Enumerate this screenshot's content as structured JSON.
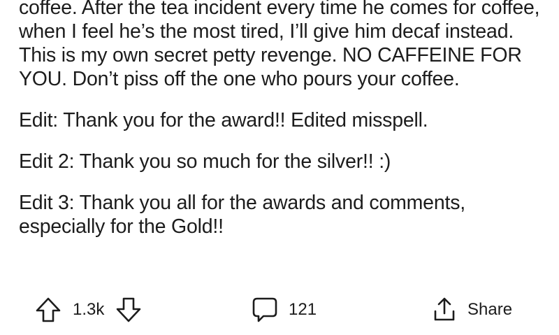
{
  "post": {
    "paragraphs": [
      "coffee. After the tea incident every time he comes for coffee, when I feel he’s the most tired, I’ll give him decaf instead. This is my own secret petty revenge. NO CAFFEINE FOR YOU. Don’t piss off the one who pours your coffee.",
      "Edit: Thank you for the award!! Edited misspell.",
      "Edit 2: Thank you so much for the silver!! :)",
      "Edit 3: Thank you all for the awards and comments, especially for the Gold!!"
    ]
  },
  "actions": {
    "vote_count": "1.3k",
    "comment_count": "121",
    "share_label": "Share",
    "icons": {
      "upvote": "upvote-arrow-icon",
      "downvote": "downvote-arrow-icon",
      "comment": "comment-bubble-icon",
      "share": "share-icon"
    }
  }
}
